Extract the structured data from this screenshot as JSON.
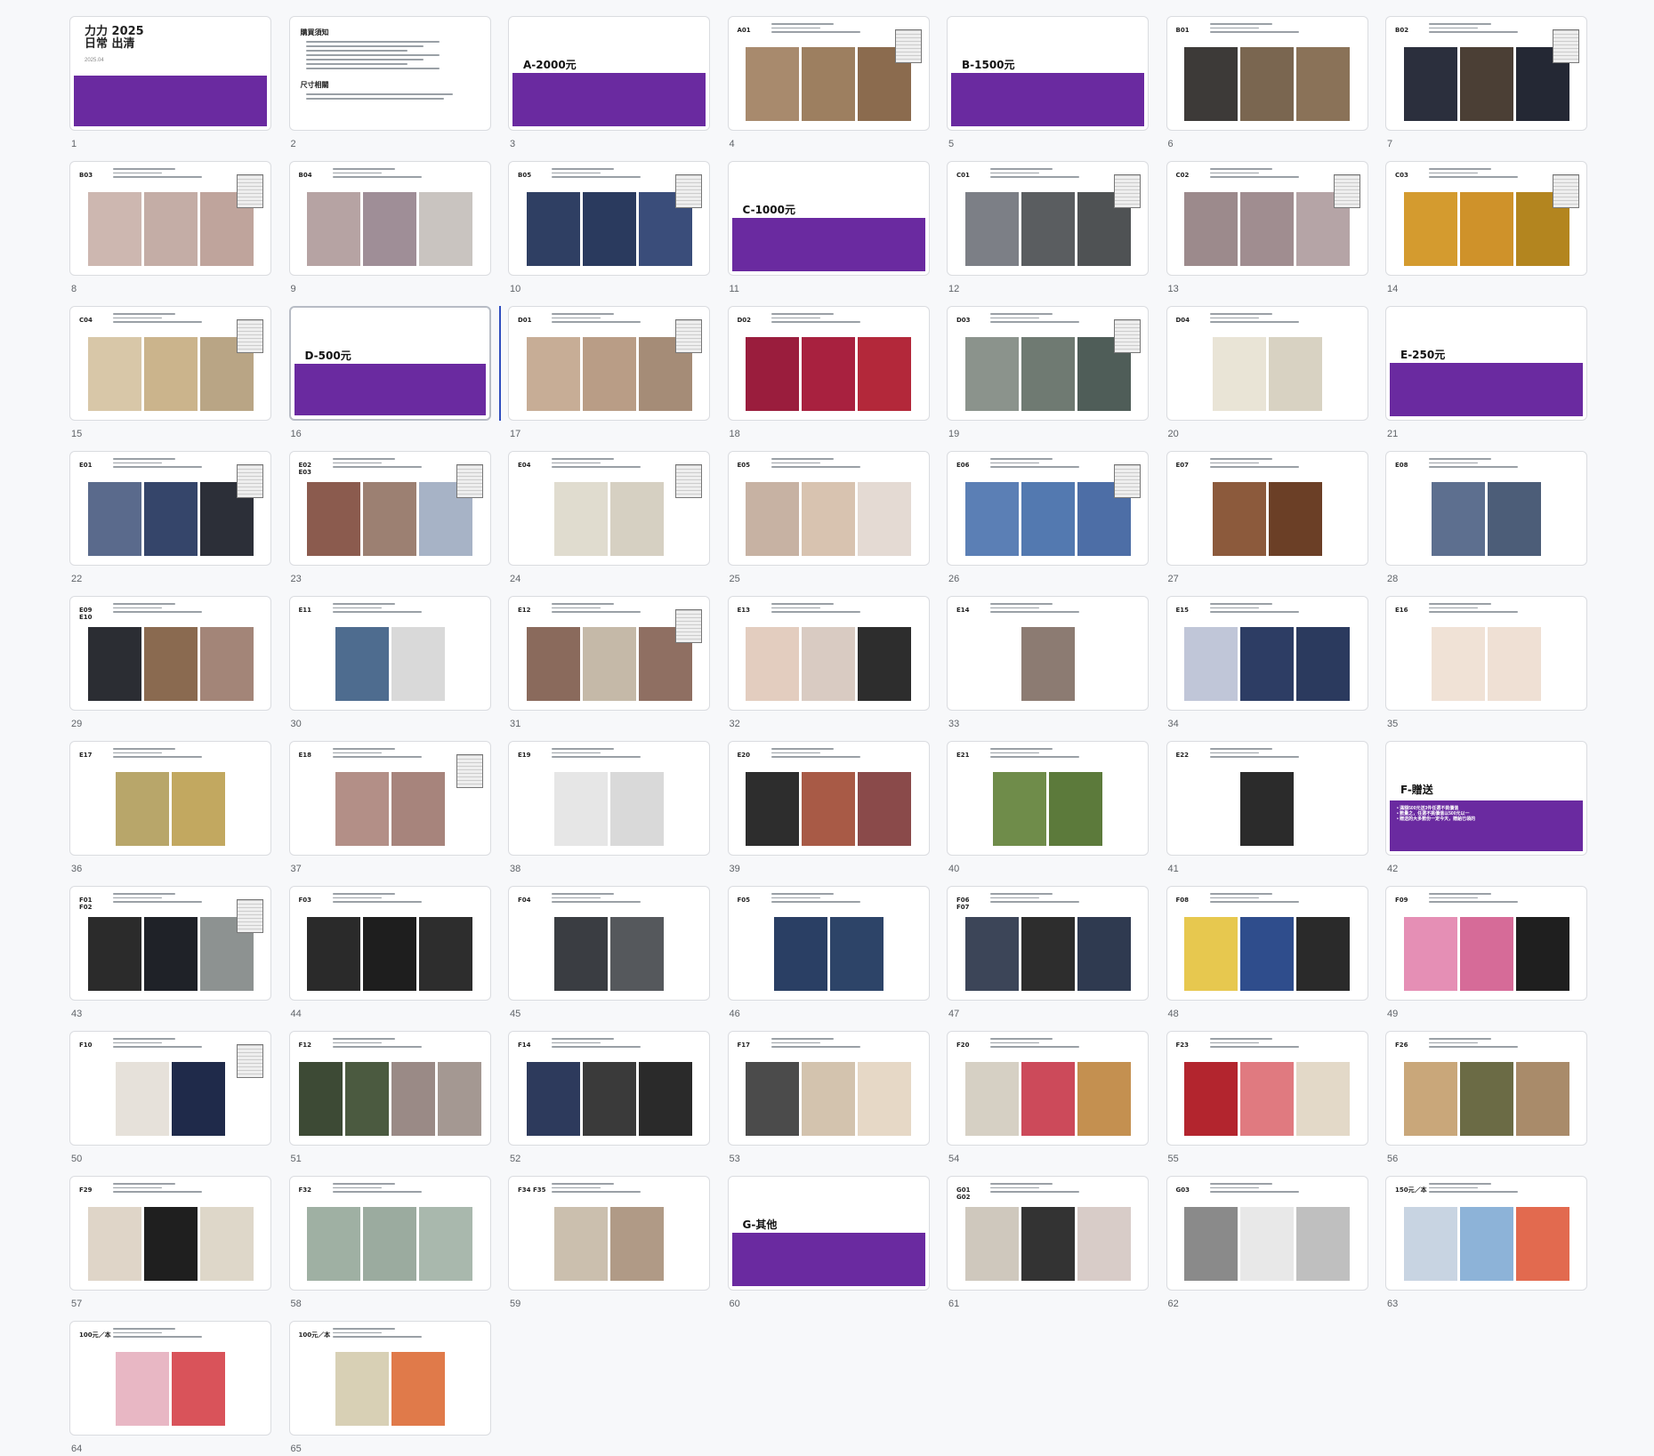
{
  "cover": {
    "title_line1": "力力 2025",
    "title_line2": "日常 出清",
    "date": "2025.04"
  },
  "notes": {
    "heading1": "購買須知",
    "heading2": "尺寸相關"
  },
  "colors": {
    "accent": "#6a2aa0"
  },
  "slides": [
    {
      "n": "1",
      "type": "cover"
    },
    {
      "n": "2",
      "type": "notes"
    },
    {
      "n": "3",
      "type": "section",
      "title": "A-2000元"
    },
    {
      "n": "4",
      "type": "item",
      "code": "A01",
      "photos": [
        "#a88a6d",
        "#9d7f60",
        "#8b6b4e"
      ],
      "tag": true
    },
    {
      "n": "5",
      "type": "section",
      "title": "B-1500元"
    },
    {
      "n": "6",
      "type": "item",
      "code": "B01",
      "photos": [
        "#3d3a38",
        "#7a6650",
        "#8a7258"
      ]
    },
    {
      "n": "7",
      "type": "item",
      "code": "B02",
      "photos": [
        "#2b2f3d",
        "#4b3f35",
        "#242834"
      ],
      "tag": true
    },
    {
      "n": "8",
      "type": "item",
      "code": "B03",
      "photos": [
        "#cdb7b0",
        "#c4ada6",
        "#bfa49c"
      ],
      "tag": true
    },
    {
      "n": "9",
      "type": "item",
      "code": "B04",
      "photos": [
        "#b6a3a3",
        "#9f8e97",
        "#c9c4c0"
      ]
    },
    {
      "n": "10",
      "type": "item",
      "code": "B05",
      "photos": [
        "#2f3f63",
        "#2a3a5e",
        "#3a4d7a"
      ],
      "tag": true
    },
    {
      "n": "11",
      "type": "section",
      "title": "C-1000元"
    },
    {
      "n": "12",
      "type": "item",
      "code": "C01",
      "photos": [
        "#7c7f86",
        "#5a5d60",
        "#4f5254"
      ],
      "tag": true
    },
    {
      "n": "13",
      "type": "item",
      "code": "C02",
      "photos": [
        "#9c8a8c",
        "#a08d90",
        "#b5a4a6"
      ],
      "tag": true
    },
    {
      "n": "14",
      "type": "item",
      "code": "C03",
      "photos": [
        "#d49b2f",
        "#cf922a",
        "#b3851f"
      ],
      "tag": true
    },
    {
      "n": "15",
      "type": "item",
      "code": "C04",
      "photos": [
        "#d8c7a8",
        "#cbb48c",
        "#b9a585"
      ],
      "tag": true
    },
    {
      "n": "16",
      "type": "section",
      "title": "D-500元",
      "selected": true
    },
    {
      "n": "17",
      "type": "item",
      "code": "D01",
      "photos": [
        "#c7ad96",
        "#b99d86",
        "#a58c77"
      ],
      "tag": true,
      "caret": true
    },
    {
      "n": "18",
      "type": "item",
      "code": "D02",
      "photos": [
        "#9a1d3d",
        "#a8213f",
        "#b3283a"
      ]
    },
    {
      "n": "19",
      "type": "item",
      "code": "D03",
      "photos": [
        "#8b938c",
        "#6f7a72",
        "#4f5d58"
      ],
      "tag": true
    },
    {
      "n": "20",
      "type": "item",
      "code": "D04",
      "photos": [
        "#e9e4d6",
        "#d8d2c2"
      ]
    },
    {
      "n": "21",
      "type": "section",
      "title": "E-250元"
    },
    {
      "n": "22",
      "type": "item",
      "code": "E01",
      "photos": [
        "#5a6a8c",
        "#35456a",
        "#2c2f38"
      ],
      "tag": true
    },
    {
      "n": "23",
      "type": "item",
      "code": "E02\nE03",
      "photos": [
        "#8b5b4e",
        "#9c8072",
        "#a7b3c6"
      ],
      "tag": true
    },
    {
      "n": "24",
      "type": "item",
      "code": "E04",
      "photos": [
        "#e0dccf",
        "#d6d0c2"
      ],
      "tag": true
    },
    {
      "n": "25",
      "type": "item",
      "code": "E05",
      "photos": [
        "#c7b2a3",
        "#d8c3b0",
        "#e4dad3"
      ]
    },
    {
      "n": "26",
      "type": "item",
      "code": "E06",
      "photos": [
        "#5b7fb5",
        "#5379b0",
        "#4d6ea6"
      ],
      "tag": true
    },
    {
      "n": "27",
      "type": "item",
      "code": "E07",
      "photos": [
        "#8c5a3c",
        "#6b3f26"
      ]
    },
    {
      "n": "28",
      "type": "item",
      "code": "E08",
      "photos": [
        "#5d6f8f",
        "#4c5d78"
      ]
    },
    {
      "n": "29",
      "type": "item",
      "code": "E09\nE10",
      "photos": [
        "#2b2d33",
        "#8a6a50",
        "#a38578"
      ]
    },
    {
      "n": "30",
      "type": "item",
      "code": "E11",
      "photos": [
        "#4e6c8f",
        "#d9d9d9"
      ]
    },
    {
      "n": "31",
      "type": "item",
      "code": "E12",
      "photos": [
        "#8a6a5c",
        "#c5b9a8",
        "#8f6f62"
      ],
      "tag": true
    },
    {
      "n": "32",
      "type": "item",
      "code": "E13",
      "photos": [
        "#e3cdbf",
        "#d9cbc2",
        "#2d2d2d"
      ]
    },
    {
      "n": "33",
      "type": "item",
      "code": "E14",
      "photos": [
        "#8c7b72"
      ]
    },
    {
      "n": "34",
      "type": "item",
      "code": "E15",
      "photos": [
        "#c0c6d8",
        "#2d3d64",
        "#2b3a5e"
      ]
    },
    {
      "n": "35",
      "type": "item",
      "code": "E16",
      "photos": [
        "#f0e2d6",
        "#efe0d4"
      ]
    },
    {
      "n": "36",
      "type": "item",
      "code": "E17",
      "photos": [
        "#b8a66a",
        "#c2a860"
      ]
    },
    {
      "n": "37",
      "type": "item",
      "code": "E18",
      "photos": [
        "#b38f87",
        "#a7847c"
      ],
      "tag": true
    },
    {
      "n": "38",
      "type": "item",
      "code": "E19",
      "photos": [
        "#e6e6e6",
        "#d9d9d9"
      ]
    },
    {
      "n": "39",
      "type": "item",
      "code": "E20",
      "photos": [
        "#2d2d2d",
        "#a85a46",
        "#8a4a4a"
      ]
    },
    {
      "n": "40",
      "type": "item",
      "code": "E21",
      "photos": [
        "#6f8c4a",
        "#5c7a3b"
      ]
    },
    {
      "n": "41",
      "type": "item",
      "code": "E22",
      "photos": [
        "#2b2b2b"
      ]
    },
    {
      "n": "42",
      "type": "section",
      "title": "F-贈送",
      "bullets": [
        "滿額500元送3件任選不挑價值",
        "數量之，任選不挑價值以500元以一",
        "贈送的大多數份一定今天，贈給已領的"
      ]
    },
    {
      "n": "43",
      "type": "item",
      "code": "F01\nF02",
      "photos": [
        "#2b2b2b",
        "#1f2228",
        "#8d9291"
      ],
      "tag": true
    },
    {
      "n": "44",
      "type": "item",
      "code": "F03",
      "photos": [
        "#2a2a2a",
        "#1e1e1e",
        "#2d2d2d"
      ]
    },
    {
      "n": "45",
      "type": "item",
      "code": "F04",
      "photos": [
        "#3a3d42",
        "#55585c"
      ]
    },
    {
      "n": "46",
      "type": "item",
      "code": "F05",
      "photos": [
        "#2a3f64",
        "#2d4468"
      ]
    },
    {
      "n": "47",
      "type": "item",
      "code": "F06\nF07",
      "photos": [
        "#3c4558",
        "#2d2d2d",
        "#2f3a50"
      ]
    },
    {
      "n": "48",
      "type": "item",
      "code": "F08",
      "photos": [
        "#e7c84f",
        "#2f4d8c",
        "#2a2a2a"
      ]
    },
    {
      "n": "49",
      "type": "item",
      "code": "F09",
      "photos": [
        "#e58fb5",
        "#d66b98",
        "#1f1f1f"
      ]
    },
    {
      "n": "50",
      "type": "item",
      "code": "F10",
      "photos": [
        "#e6e1da",
        "#1f2a4a"
      ],
      "tag": true
    },
    {
      "n": "51",
      "type": "item",
      "code": "F12",
      "photos": [
        "#3d4a35",
        "#4b5a40",
        "#9a8a86",
        "#a49892"
      ]
    },
    {
      "n": "52",
      "type": "item",
      "code": "F14",
      "photos": [
        "#2d3a5c",
        "#3a3a3a",
        "#2a2a2a"
      ]
    },
    {
      "n": "53",
      "type": "item",
      "code": "F17",
      "photos": [
        "#4b4b4b",
        "#d3c3ae",
        "#e6d8c6"
      ]
    },
    {
      "n": "54",
      "type": "item",
      "code": "F20",
      "photos": [
        "#d6d0c4",
        "#cc4a5a",
        "#c49050"
      ]
    },
    {
      "n": "55",
      "type": "item",
      "code": "F23",
      "photos": [
        "#b3252e",
        "#e07a80",
        "#e3d9c8"
      ]
    },
    {
      "n": "56",
      "type": "item",
      "code": "F26",
      "photos": [
        "#c9a77a",
        "#6b6b45",
        "#a98b6a"
      ]
    },
    {
      "n": "57",
      "type": "item",
      "code": "F29",
      "photos": [
        "#dfd5c8",
        "#1f1f1f",
        "#ded7c9"
      ]
    },
    {
      "n": "58",
      "type": "item",
      "code": "F32",
      "photos": [
        "#9fb0a3",
        "#9bab9f",
        "#a9b8ad"
      ]
    },
    {
      "n": "59",
      "type": "item",
      "code": "F34 F35",
      "photos": [
        "#cbbfae",
        "#b09a86"
      ]
    },
    {
      "n": "60",
      "type": "section",
      "title": "G-其他"
    },
    {
      "n": "61",
      "type": "item",
      "code": "G01\nG02",
      "photos": [
        "#cfc8bd",
        "#333333",
        "#d8ccc8"
      ]
    },
    {
      "n": "62",
      "type": "item",
      "code": "G03",
      "photos": [
        "#8a8a8a",
        "#e8e8e8",
        "#bfbfbf"
      ]
    },
    {
      "n": "63",
      "type": "item",
      "code": "150元／本",
      "photos": [
        "#c8d4e2",
        "#8db3d8",
        "#e26a4f"
      ]
    },
    {
      "n": "64",
      "type": "item",
      "code": "100元／本",
      "photos": [
        "#e8b7c4",
        "#d9535a"
      ]
    },
    {
      "n": "65",
      "type": "item",
      "code": "100元／本",
      "photos": [
        "#d8d0b5",
        "#e07a4a"
      ]
    }
  ]
}
